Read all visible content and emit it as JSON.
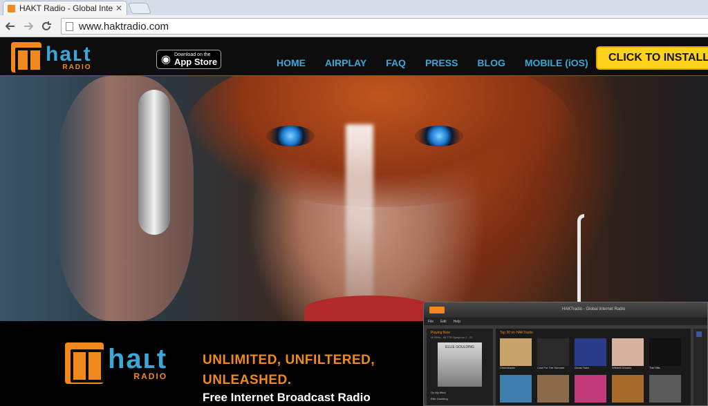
{
  "browser": {
    "tab_title": "HAKT Radio - Global Intern",
    "tab_close": "✕",
    "back_icon": "arrow-left-icon",
    "forward_icon": "arrow-right-icon",
    "reload_icon": "reload-icon",
    "url": "www.haktradio.com"
  },
  "header": {
    "logo_name": "haʟt",
    "logo_sub": "RADIO",
    "appstore_small": "Download on the",
    "appstore_big": "App Store",
    "nav": [
      "HOME",
      "AIRPLAY",
      "FAQ",
      "PRESS",
      "BLOG",
      "MOBILE (iOS)"
    ],
    "install_label": "CLICK TO INSTALL"
  },
  "lower": {
    "logo_name": "haʟt",
    "logo_sub": "RADIO",
    "tagline_line1": "UNLIMITED, UNFILTERED,",
    "tagline_line2": "UNLEASHED.",
    "subline": "Free Internet Broadcast Radio"
  },
  "app_screenshot": {
    "title": "HAKTradio - Global Internet Radio",
    "menu": [
      "File",
      "Edit",
      "Help"
    ],
    "now_playing": "Playing Now",
    "now_sub": "Hi 95Hz - 96 TTR Symphon 2 - 22",
    "album_label": "ELLIE GOULDING",
    "track": "On My Mind",
    "track_artist": "Ellie Goulding",
    "top30": "Top 30 on HAKTradio",
    "tiles": [
      {
        "label": "Cheerleader",
        "color": "#c9a36a"
      },
      {
        "label": "Cool For The Summer",
        "color": "#2a2a2a"
      },
      {
        "label": "Ghost Town",
        "color": "#2b3c8a"
      },
      {
        "label": "Wildest Dreams",
        "color": "#d8b2a0"
      },
      {
        "label": "The Hills",
        "color": "#111111"
      },
      {
        "label": "",
        "color": "#3f7fae"
      },
      {
        "label": "",
        "color": "#8a6a4a"
      },
      {
        "label": "",
        "color": "#c23a7a"
      },
      {
        "label": "",
        "color": "#a66a2a"
      },
      {
        "label": "",
        "color": "#5a5a5a"
      }
    ]
  }
}
